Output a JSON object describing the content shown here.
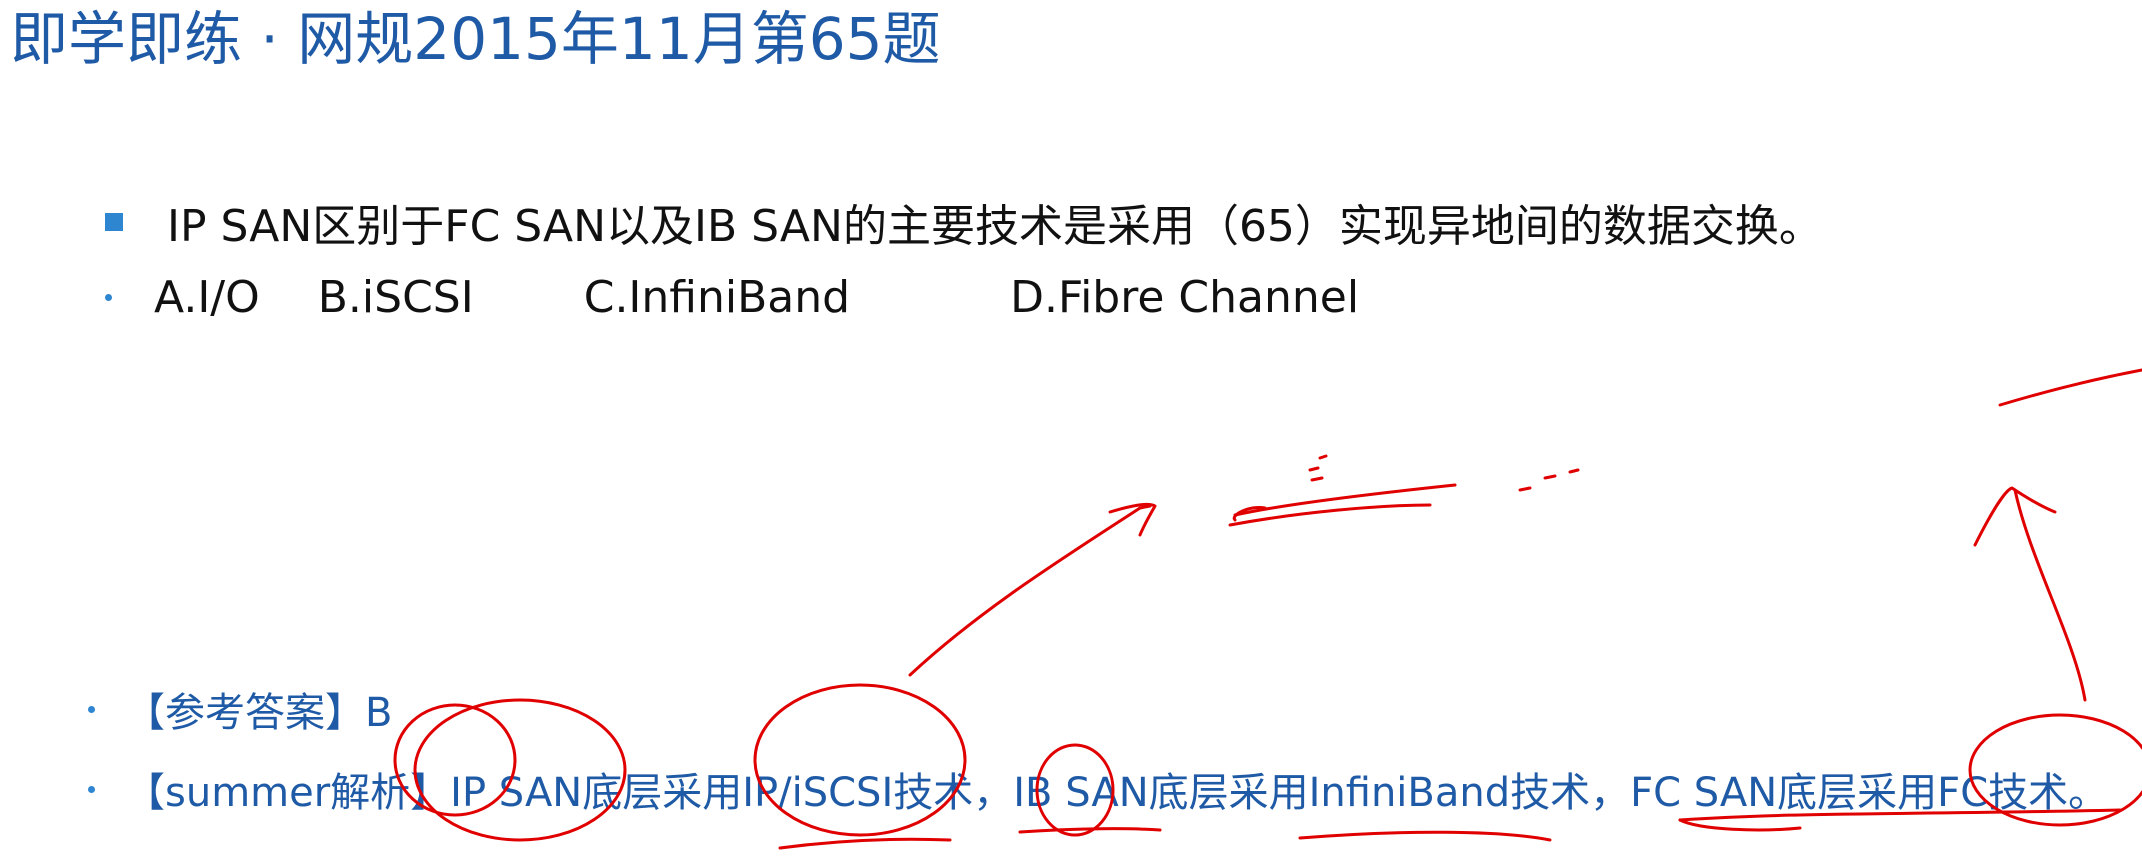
{
  "title": "即学即练 · 网规2015年11月第65题",
  "question": {
    "text": "IP SAN区别于FC SAN以及IB SAN的主要技术是采用（65）实现异地间的数据交换。"
  },
  "options": {
    "a": "A.I/O",
    "b": "B.iSCSI",
    "c": "C.InfiniBand",
    "d": "D.Fibre Channel"
  },
  "answer": {
    "text": "【参考答案】B"
  },
  "analysis": {
    "text": "【summer解析】IP SAN底层采用IP/iSCSI技术，IB SAN底层采用InfiniBand技术，FC SAN底层采用FC技术。"
  },
  "colors": {
    "title": "#1f5aa6",
    "bullet": "#2e86d1",
    "body_text": "#111111",
    "annotation_ink": "#e00000"
  }
}
